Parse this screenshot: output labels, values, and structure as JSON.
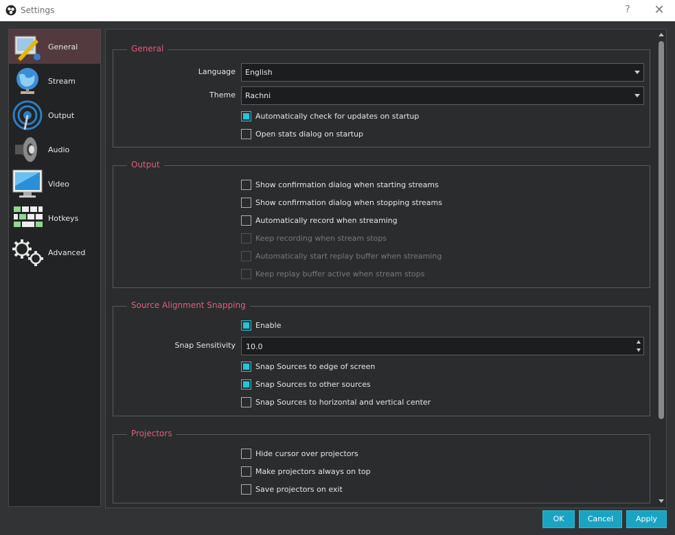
{
  "window": {
    "title": "Settings",
    "help_glyph": "?",
    "close_glyph": "✕"
  },
  "sidebar": {
    "items": [
      {
        "label": "General",
        "icon": "general-icon",
        "active": true
      },
      {
        "label": "Stream",
        "icon": "stream-icon",
        "active": false
      },
      {
        "label": "Output",
        "icon": "output-icon",
        "active": false
      },
      {
        "label": "Audio",
        "icon": "audio-icon",
        "active": false
      },
      {
        "label": "Video",
        "icon": "video-icon",
        "active": false
      },
      {
        "label": "Hotkeys",
        "icon": "hotkeys-icon",
        "active": false
      },
      {
        "label": "Advanced",
        "icon": "advanced-icon",
        "active": false
      }
    ]
  },
  "general": {
    "title": "General",
    "language_label": "Language",
    "language_value": "English",
    "theme_label": "Theme",
    "theme_value": "Rachni",
    "options": [
      {
        "label": "Automatically check for updates on startup",
        "checked": true,
        "disabled": false
      },
      {
        "label": "Open stats dialog on startup",
        "checked": false,
        "disabled": false
      }
    ]
  },
  "output": {
    "title": "Output",
    "options": [
      {
        "label": "Show confirmation dialog when starting streams",
        "checked": false,
        "disabled": false
      },
      {
        "label": "Show confirmation dialog when stopping streams",
        "checked": false,
        "disabled": false
      },
      {
        "label": "Automatically record when streaming",
        "checked": false,
        "disabled": false
      },
      {
        "label": "Keep recording when stream stops",
        "checked": false,
        "disabled": true
      },
      {
        "label": "Automatically start replay buffer when streaming",
        "checked": false,
        "disabled": true
      },
      {
        "label": "Keep replay buffer active when stream stops",
        "checked": false,
        "disabled": true
      }
    ]
  },
  "snapping": {
    "title": "Source Alignment Snapping",
    "enable": {
      "label": "Enable",
      "checked": true
    },
    "sensitivity_label": "Snap Sensitivity",
    "sensitivity_value": "10.0",
    "options": [
      {
        "label": "Snap Sources to edge of screen",
        "checked": true,
        "disabled": false
      },
      {
        "label": "Snap Sources to other sources",
        "checked": true,
        "disabled": false
      },
      {
        "label": "Snap Sources to horizontal and vertical center",
        "checked": false,
        "disabled": false
      }
    ]
  },
  "projectors": {
    "title": "Projectors",
    "options": [
      {
        "label": "Hide cursor over projectors",
        "checked": false,
        "disabled": false
      },
      {
        "label": "Make projectors always on top",
        "checked": false,
        "disabled": false
      },
      {
        "label": "Save projectors on exit",
        "checked": false,
        "disabled": false
      }
    ]
  },
  "buttons": {
    "ok": "OK",
    "cancel": "Cancel",
    "apply": "Apply"
  },
  "colors": {
    "accent": "#1fc7d8",
    "section_title": "#e15e7c",
    "button": "#1aa4c3",
    "active_nav": "#523a3f"
  }
}
